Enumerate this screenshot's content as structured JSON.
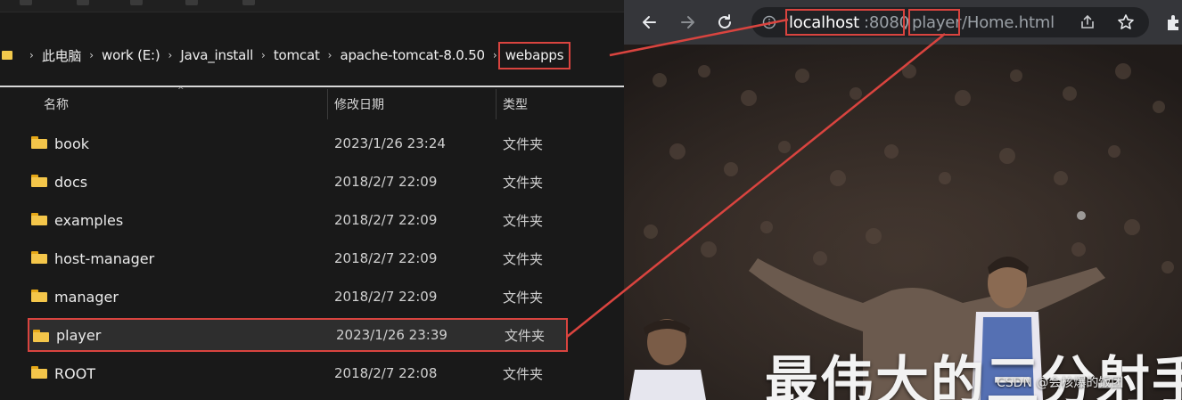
{
  "explorer": {
    "breadcrumb": [
      "此电脑",
      "work (E:)",
      "Java_install",
      "tomcat",
      "apache-tomcat-8.0.50",
      "webapps"
    ],
    "columns": {
      "name": "名称",
      "date": "修改日期",
      "type": "类型"
    },
    "rows": [
      {
        "name": "book",
        "date": "2023/1/26 23:24",
        "type": "文件夹"
      },
      {
        "name": "docs",
        "date": "2018/2/7 22:09",
        "type": "文件夹"
      },
      {
        "name": "examples",
        "date": "2018/2/7 22:09",
        "type": "文件夹"
      },
      {
        "name": "host-manager",
        "date": "2018/2/7 22:09",
        "type": "文件夹"
      },
      {
        "name": "manager",
        "date": "2018/2/7 22:09",
        "type": "文件夹"
      },
      {
        "name": "player",
        "date": "2023/1/26 23:39",
        "type": "文件夹"
      },
      {
        "name": "ROOT",
        "date": "2018/2/7 22:08",
        "type": "文件夹"
      }
    ],
    "selected_row": "player"
  },
  "browser": {
    "url": {
      "host": "localhost",
      "port": ":8080",
      "slash": "/",
      "path_segment": "player",
      "rest": "/Home.html"
    },
    "icons": [
      "back-icon",
      "forward-icon",
      "reload-icon",
      "site-info-icon",
      "share-icon",
      "bookmark-star-icon",
      "extensions-icon"
    ]
  },
  "hero": {
    "headline": "最伟大的三分射手",
    "watermark": "CSDN @会核爆的饭团"
  },
  "colors": {
    "annotation_red": "#d9443f",
    "folder_yellow": "#f4c64a",
    "explorer_bg": "#191919",
    "browser_toolbar": "#35363a"
  }
}
